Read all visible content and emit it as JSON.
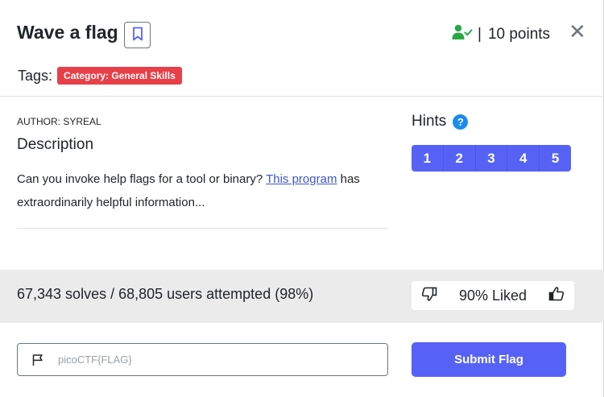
{
  "challenge": {
    "title": "Wave a flag",
    "points": "10 points",
    "points_separator": "|",
    "tags_label": "Tags:",
    "tag": "Category: General Skills",
    "close_glyph": "✕"
  },
  "description": {
    "author": "AUTHOR: SYREAL",
    "heading": "Description",
    "text_before": "Can you invoke help flags for a tool or binary? ",
    "link_text": "This program",
    "text_after": " has extraordinarily helpful information..."
  },
  "hints": {
    "heading": "Hints",
    "help_glyph": "?",
    "items": [
      "1",
      "2",
      "3",
      "4",
      "5"
    ]
  },
  "stats": {
    "solves": "67,343 solves / 68,805 users attempted (98%)",
    "liked": "90% Liked"
  },
  "flag_form": {
    "placeholder": "picoCTF{FLAG}",
    "submit_label": "Submit Flag"
  },
  "colors": {
    "accent": "#5662f6",
    "tag_red": "#e84049",
    "solved_green": "#28a745",
    "help_blue": "#1a8cf0",
    "stats_bg": "#ebebeb"
  },
  "icons": {
    "bookmark": "bookmark-icon",
    "solved": "user-check-icon",
    "close": "close-icon",
    "help": "question-circle-icon",
    "dislike": "thumbs-down-icon",
    "like": "thumbs-up-icon",
    "flag": "flag-icon"
  }
}
